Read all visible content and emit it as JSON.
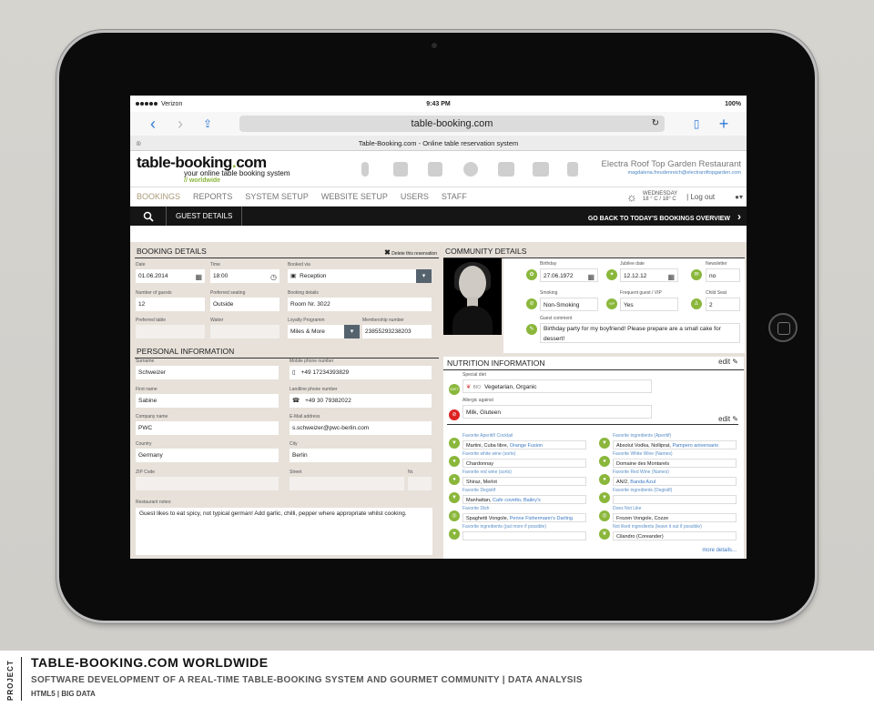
{
  "status": {
    "carrier": "Verizon",
    "time": "9:43 PM",
    "battery": "100%"
  },
  "browser": {
    "url": "table-booking.com",
    "tab_title": "Table-Booking.com - Online table reservation system"
  },
  "header": {
    "logo_main": "table-booking",
    "logo_dot": ".",
    "logo_com": "com",
    "tagline": "your online table booking system",
    "worldwide": "// worldwide",
    "restaurant": "Electra Roof Top Garden Restaurant",
    "email": "magdalena.freudenreich@electraroftopgarden.com"
  },
  "menu": {
    "items": [
      "BOOKINGS",
      "REPORTS",
      "SYSTEM SETUP",
      "WEBSITE SETUP",
      "USERS",
      "STAFF"
    ],
    "weather_day": "WEDNESDAY",
    "weather_temp": "18 ° C / 18° C",
    "logout": "| Log out"
  },
  "toolbar": {
    "guest_details": "GUEST DETAILS",
    "back": "GO BACK TO TODAY'S BOOKINGS OVERVIEW"
  },
  "booking": {
    "title": "BOOKING DETAILS",
    "delete": "Delete this reservation",
    "date_label": "Date",
    "date": "01.06.2014",
    "time_label": "Time",
    "time": "18:00",
    "via_label": "Booked via",
    "via": "Reception",
    "guests_label": "Number of guests",
    "guests": "12",
    "seating_label": "Preferred seating",
    "seating": "Outside",
    "details_label": "Booking details",
    "details": "Room Nr. 3022",
    "table_label": "Preferred table",
    "table": "",
    "waiter_label": "Waiter",
    "waiter": "",
    "loyalty_label": "Loyalty Programm",
    "loyalty": "Miles & More",
    "membership_label": "Membership number",
    "membership": "23855293238203"
  },
  "personal": {
    "title": "PERSONAL INFORMATION",
    "surname_label": "Surname",
    "surname": "Schweizer",
    "mobile_label": "Mobile phone number",
    "mobile": "+49 17234393829",
    "first_label": "First name",
    "first": "Sabine",
    "landline_label": "Landline phone number",
    "landline": "+49 30 79382022",
    "company_label": "Company name",
    "company": "PWC",
    "email_label": "E-Mail address",
    "email": "s.schweizer@pwc-berlin.com",
    "country_label": "Country",
    "country": "Germany",
    "city_label": "City",
    "city": "Berlin",
    "zip_label": "ZIP Code",
    "street_label": "Street",
    "nr_label": "Nr.",
    "notes_label": "Restaurant notes:",
    "notes": "Guest likes to eat spicy, not typical german! Add garlic, chilli, pepper where appropriate whilst cooking."
  },
  "community": {
    "title": "COMMUNITY DETAILS",
    "birthday_label": "Birthday",
    "birthday": "27.06.1972",
    "jubilee_label": "Jubilee date",
    "jubilee": "12.12.12",
    "newsletter_label": "Newsletter",
    "newsletter": "no",
    "smoking_label": "Smoking",
    "smoking": "Non-Smoking",
    "frequent_label": "Frequent guest / VIP",
    "frequent": "Yes",
    "child_label": "Child Seat",
    "child": "2",
    "comment_label": "Guest comment",
    "comment": "Birthday party for my boyfriend! Please prepare are a small cake for dessert!"
  },
  "nutrition": {
    "title": "NUTRITION INFORMATION",
    "edit": "edit",
    "diet_label": "Special diet",
    "diet_bio": "BIO",
    "diet": "Vegetarian, Organic",
    "allergic_label": "Allergic against",
    "allergic": "Milk, Gluteen",
    "fav": [
      {
        "l": "Favorite Aperitif/ Cocktail",
        "v": "Martini, Cuba libre, ",
        "h": "Orange Fusion"
      },
      {
        "l": "Favorite ingredients (Aperitif)",
        "v": "Absolut Vodka, Nolliprat, ",
        "h": "Pampero aniversario"
      },
      {
        "l": "Favorite white wine (sorts)",
        "v": "Chardonnay",
        "h": ""
      },
      {
        "l": "Favorite White Wine (Names)",
        "v": "Domaine des Montarels",
        "h": ""
      },
      {
        "l": "Favorite red wine (sorts)",
        "v": "Shiraz, Merlot",
        "h": ""
      },
      {
        "l": "Favorite Red Wine (Names)",
        "v": "AN/2, ",
        "h": "Banda Azul"
      },
      {
        "l": "Favorite Degistif",
        "v": "Manhattan, ",
        "h": "Cafe covetto, Bailey's"
      },
      {
        "l": "Favorite ingredients (Degistif)",
        "v": "",
        "h": ""
      },
      {
        "l": "Favorite Dish",
        "v": "Spaghetti Vongole, ",
        "h": "Penne Fishermann's Darling"
      },
      {
        "l": "Does Not Like",
        "v": "Frozen Vongole, Cozze",
        "h": ""
      },
      {
        "l": "Favorite ingredients (put more if possible)",
        "v": "",
        "h": ""
      },
      {
        "l": "Not liked ingredients (leave it out if possible)",
        "v": "Cilandro (Coreander)",
        "h": ""
      }
    ],
    "more": "more details..."
  },
  "caption": {
    "project": "PROJECT",
    "title": "TABLE-BOOKING.COM WORLDWIDE",
    "subtitle": "SOFTWARE DEVELOPMENT OF A REAL-TIME TABLE-BOOKING SYSTEM AND GOURMET COMMUNITY | DATA ANALYSIS",
    "tags": "HTML5 | BIG DATA"
  }
}
